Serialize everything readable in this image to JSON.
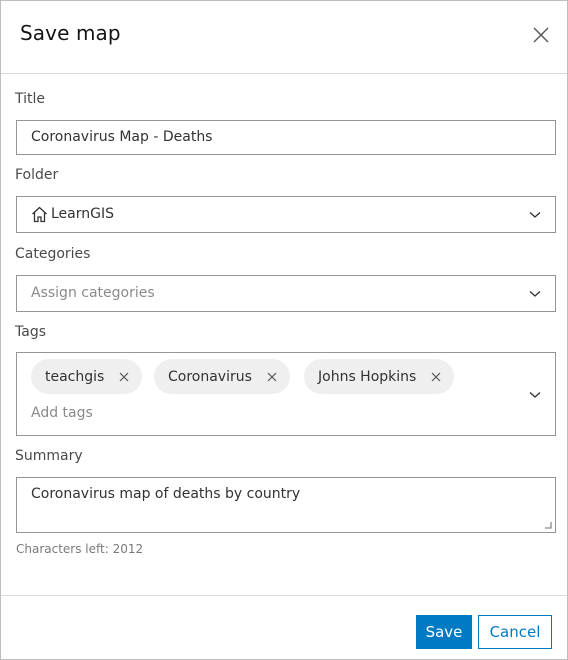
{
  "dialog": {
    "title": "Save map",
    "close_icon": "close-icon"
  },
  "form": {
    "title": {
      "label": "Title",
      "value": "Coronavirus Map - Deaths"
    },
    "folder": {
      "label": "Folder",
      "icon": "home-icon",
      "value": "LearnGIS"
    },
    "categories": {
      "label": "Categories",
      "placeholder": "Assign categories"
    },
    "tags": {
      "label": "Tags",
      "items": [
        "teachgis",
        "Coronavirus",
        "Johns Hopkins"
      ],
      "placeholder": "Add tags"
    },
    "summary": {
      "label": "Summary",
      "value": "Coronavirus map of deaths by country",
      "characters_left_text": "Characters left: 2012"
    }
  },
  "footer": {
    "save_label": "Save",
    "cancel_label": "Cancel"
  },
  "colors": {
    "primary": "#007ac2",
    "chip_bg": "#efefef",
    "border": "#959595"
  }
}
